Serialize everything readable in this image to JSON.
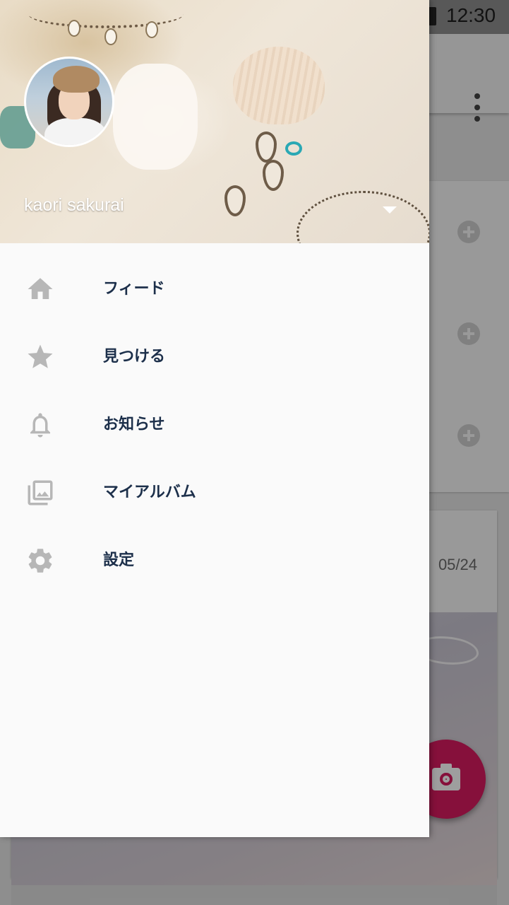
{
  "status_bar": {
    "time": "12:30"
  },
  "background": {
    "card_date": "05/24",
    "fab_icon": "camera-icon",
    "fab_color": "#d81b60"
  },
  "drawer": {
    "user": {
      "name": "kaori sakurai"
    },
    "items": [
      {
        "label": "フィード",
        "icon": "home-icon"
      },
      {
        "label": "見つける",
        "icon": "star-icon"
      },
      {
        "label": "お知らせ",
        "icon": "bell-icon"
      },
      {
        "label": "マイアルバム",
        "icon": "photo-library-icon"
      },
      {
        "label": "設定",
        "icon": "gear-icon"
      }
    ],
    "colors": {
      "label": "#1c2f4a",
      "icon": "#b7b7b7",
      "background": "#fafafa"
    }
  }
}
